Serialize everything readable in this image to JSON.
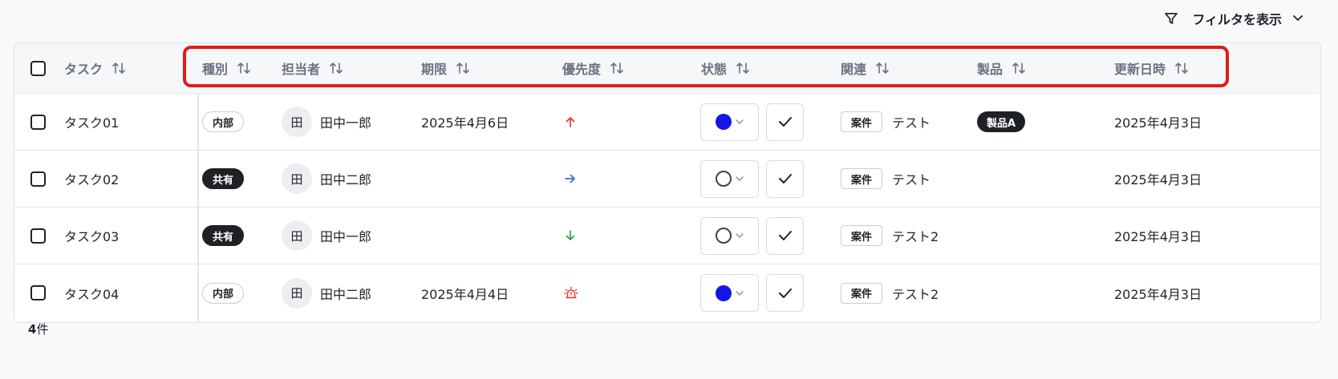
{
  "toolbar": {
    "filter_label": "フィルタを表示",
    "filter_icon": "filter-funnel-icon",
    "chevron_icon": "chevron-down-icon"
  },
  "columns": {
    "task": "タスク",
    "type": "種別",
    "assignee": "担当者",
    "due": "期限",
    "priority": "優先度",
    "status": "状態",
    "related": "関連",
    "product": "製品",
    "updated": "更新日時"
  },
  "rows": [
    {
      "task": "タスク01",
      "type": "内部",
      "type_style": "outline",
      "avatar": "田",
      "assignee": "田中一郎",
      "due": "2025年4月6日",
      "priority": "high",
      "priority_icon": "arrow-up-icon",
      "priority_color": "#e53935",
      "status": "filled",
      "related_tag": "案件",
      "related": "テスト",
      "product": "製品A",
      "updated": "2025年4月3日"
    },
    {
      "task": "タスク02",
      "type": "共有",
      "type_style": "dark",
      "avatar": "田",
      "assignee": "田中二郎",
      "due": "",
      "priority": "medium",
      "priority_icon": "arrow-right-icon",
      "priority_color": "#2f6fe0",
      "status": "empty",
      "related_tag": "案件",
      "related": "テスト",
      "product": "",
      "updated": "2025年4月3日"
    },
    {
      "task": "タスク03",
      "type": "共有",
      "type_style": "dark",
      "avatar": "田",
      "assignee": "田中一郎",
      "due": "",
      "priority": "low",
      "priority_icon": "arrow-down-icon",
      "priority_color": "#2e9d57",
      "status": "empty",
      "related_tag": "案件",
      "related": "テスト2",
      "product": "",
      "updated": "2025年4月3日"
    },
    {
      "task": "タスク04",
      "type": "内部",
      "type_style": "outline",
      "avatar": "田",
      "assignee": "田中二郎",
      "due": "2025年4月4日",
      "priority": "urgent",
      "priority_icon": "alarm-siren-icon",
      "priority_color": "#e53935",
      "status": "filled",
      "related_tag": "案件",
      "related": "テスト2",
      "product": "",
      "updated": "2025年4月3日"
    }
  ],
  "footer": {
    "count": "4",
    "unit": "件"
  },
  "colors": {
    "highlight": "#e21b1b",
    "status_filled": "#1515e8",
    "tag_dark": "#1e2126"
  }
}
